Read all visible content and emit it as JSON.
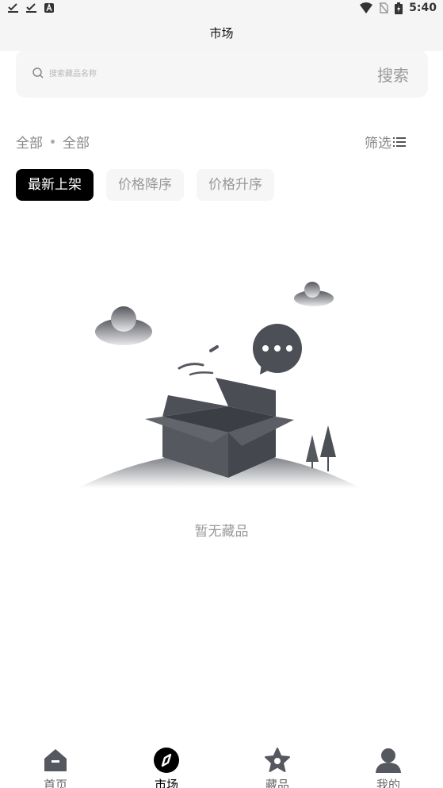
{
  "status_bar": {
    "time": "5:40"
  },
  "header": {
    "title": "市场"
  },
  "search": {
    "placeholder": "搜索藏品名称",
    "button_label": "搜索"
  },
  "filters": {
    "category": "全部",
    "subcategory": "全部",
    "filter_label": "筛选"
  },
  "sort_tabs": [
    {
      "label": "最新上架",
      "active": true
    },
    {
      "label": "价格降序",
      "active": false
    },
    {
      "label": "价格升序",
      "active": false
    }
  ],
  "empty_state": {
    "message": "暂无藏品"
  },
  "tab_bar": [
    {
      "label": "首页",
      "icon": "home-icon"
    },
    {
      "label": "市场",
      "icon": "compass-icon",
      "active": true
    },
    {
      "label": "藏品",
      "icon": "star-icon"
    },
    {
      "label": "我的",
      "icon": "user-icon"
    }
  ],
  "colors": {
    "accent": "#000000",
    "muted": "#999999",
    "surface": "#f6f6f6"
  }
}
